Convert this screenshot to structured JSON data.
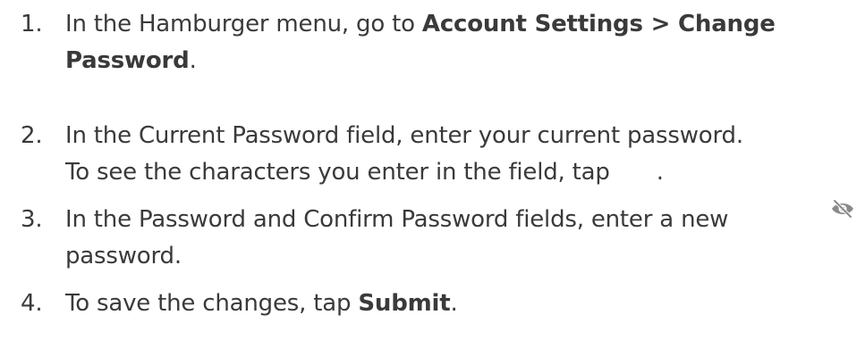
{
  "steps": [
    {
      "number": "1.",
      "line1_prefix": "In the Hamburger menu, go to ",
      "line1_bold": "Account Settings > Change",
      "line2_bold": "Password",
      "line2_suffix": "."
    },
    {
      "number": "2.",
      "line1": "In the Current Password field, enter your current password.",
      "line2_prefix": "To see the characters you enter in the field, tap",
      "line2_suffix": "."
    },
    {
      "number": "3.",
      "line1": "In the Password and Confirm Password fields, enter a new",
      "line2": "password."
    },
    {
      "number": "4.",
      "text_prefix": "To save the changes, tap ",
      "text_bold": "Submit",
      "text_suffix": "."
    }
  ],
  "icons": {
    "eye": "eye-slash-icon",
    "eye_color": "#8a8a8a"
  }
}
